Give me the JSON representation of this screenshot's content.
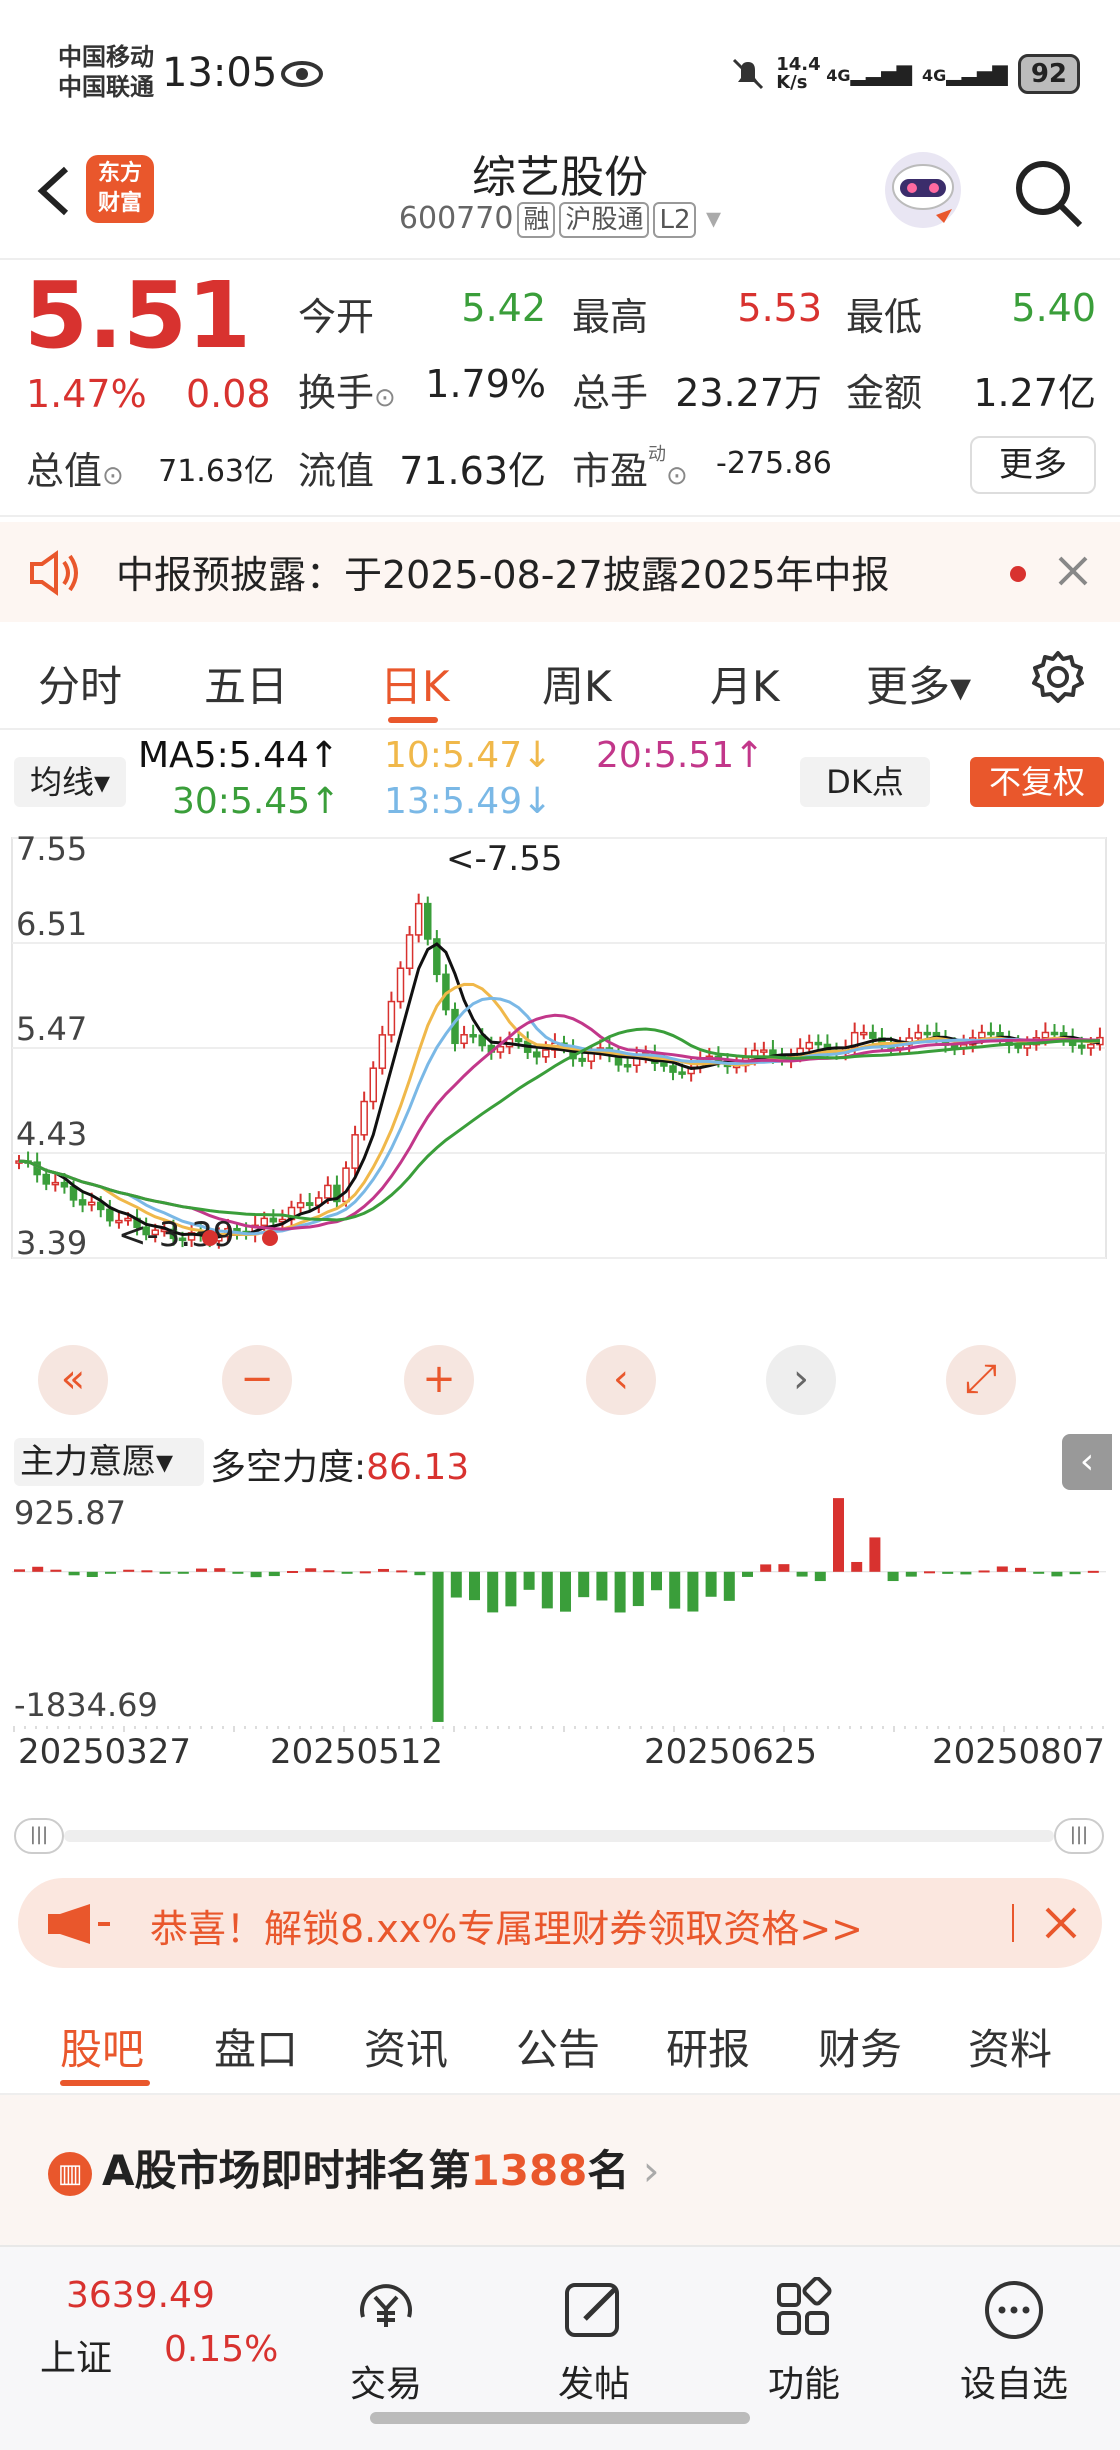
{
  "status": {
    "carrier1": "中国移动",
    "carrier2": "中国联通",
    "time": "13:05",
    "net_speed": "14.4\nK/s",
    "sig1": "4G",
    "sig2": "4G",
    "battery": "92"
  },
  "header": {
    "title": "综艺股份",
    "code": "600770",
    "tags": [
      "融",
      "沪股通",
      "L2"
    ],
    "logo_text": "东方财富"
  },
  "quote": {
    "price": "5.51",
    "pct": "1.47%",
    "change": "0.08",
    "open_label": "今开",
    "open": "5.42",
    "high_label": "最高",
    "high": "5.53",
    "low_label": "最低",
    "low": "5.40",
    "turnover_label": "换手",
    "turnover": "1.79%",
    "volume_label": "总手",
    "volume": "23.27万",
    "amount_label": "金额",
    "amount": "1.27亿",
    "mktcap_label": "总值",
    "mktcap": "71.63亿",
    "float_label": "流值",
    "float": "71.63亿",
    "pe_label": "市盈",
    "pe_sup": "动",
    "pe": "-275.86",
    "more": "更多"
  },
  "notice": {
    "text": "中报预披露：于2025-08-27披露2025年中报"
  },
  "tabs": [
    "分时",
    "五日",
    "日K",
    "周K",
    "月K",
    "更多▾"
  ],
  "active_tab": "日K",
  "ma": {
    "selector": "均线▾",
    "ma5": "MA5:5.44↑",
    "ma10": "10:5.47↓",
    "ma20": "20:5.51↑",
    "ma30": "30:5.45↑",
    "ma13": "13:5.49↓",
    "dk": "DK点",
    "fq": "不复权"
  },
  "colors": {
    "up": "#d8322f",
    "down": "#3a9e3a",
    "accent": "#e9572c",
    "ma5": "#111111",
    "ma10": "#f0b84a",
    "ma20": "#c2378a",
    "ma30": "#3a9e3a",
    "ma13": "#7ab8e6"
  },
  "chart_data": [
    {
      "type": "candlestick",
      "y_ticks": [
        "7.55",
        "6.51",
        "5.47",
        "4.43",
        "3.39"
      ],
      "ylim": [
        3.39,
        7.55
      ],
      "max_label": "<-7.55",
      "min_label": "<-3.39"
    },
    {
      "type": "bar",
      "title": "主力意愿",
      "value_label": "多空力度:",
      "value": "86.13",
      "y_ticks": [
        "925.87",
        "-1834.69"
      ],
      "ylim": [
        -1834.69,
        925.87
      ]
    }
  ],
  "dates": [
    "20250327",
    "20250512",
    "20250625",
    "20250807"
  ],
  "indicator": {
    "selector": "主力意愿▾",
    "label": "多空力度:",
    "value": "86.13"
  },
  "banner": {
    "text": "恭喜！解锁8.xx%专属理财券领取资格>>"
  },
  "subtabs": [
    "股吧",
    "盘口",
    "资讯",
    "公告",
    "研报",
    "财务",
    "资料"
  ],
  "rank": {
    "prefix": "A股市场即时排名第",
    "num": "1388",
    "suffix": "名"
  },
  "bottom": {
    "index_value": "3639.49",
    "index_name": "上证",
    "index_pct": "0.15%",
    "items": [
      "交易",
      "发帖",
      "功能",
      "设自选"
    ]
  }
}
